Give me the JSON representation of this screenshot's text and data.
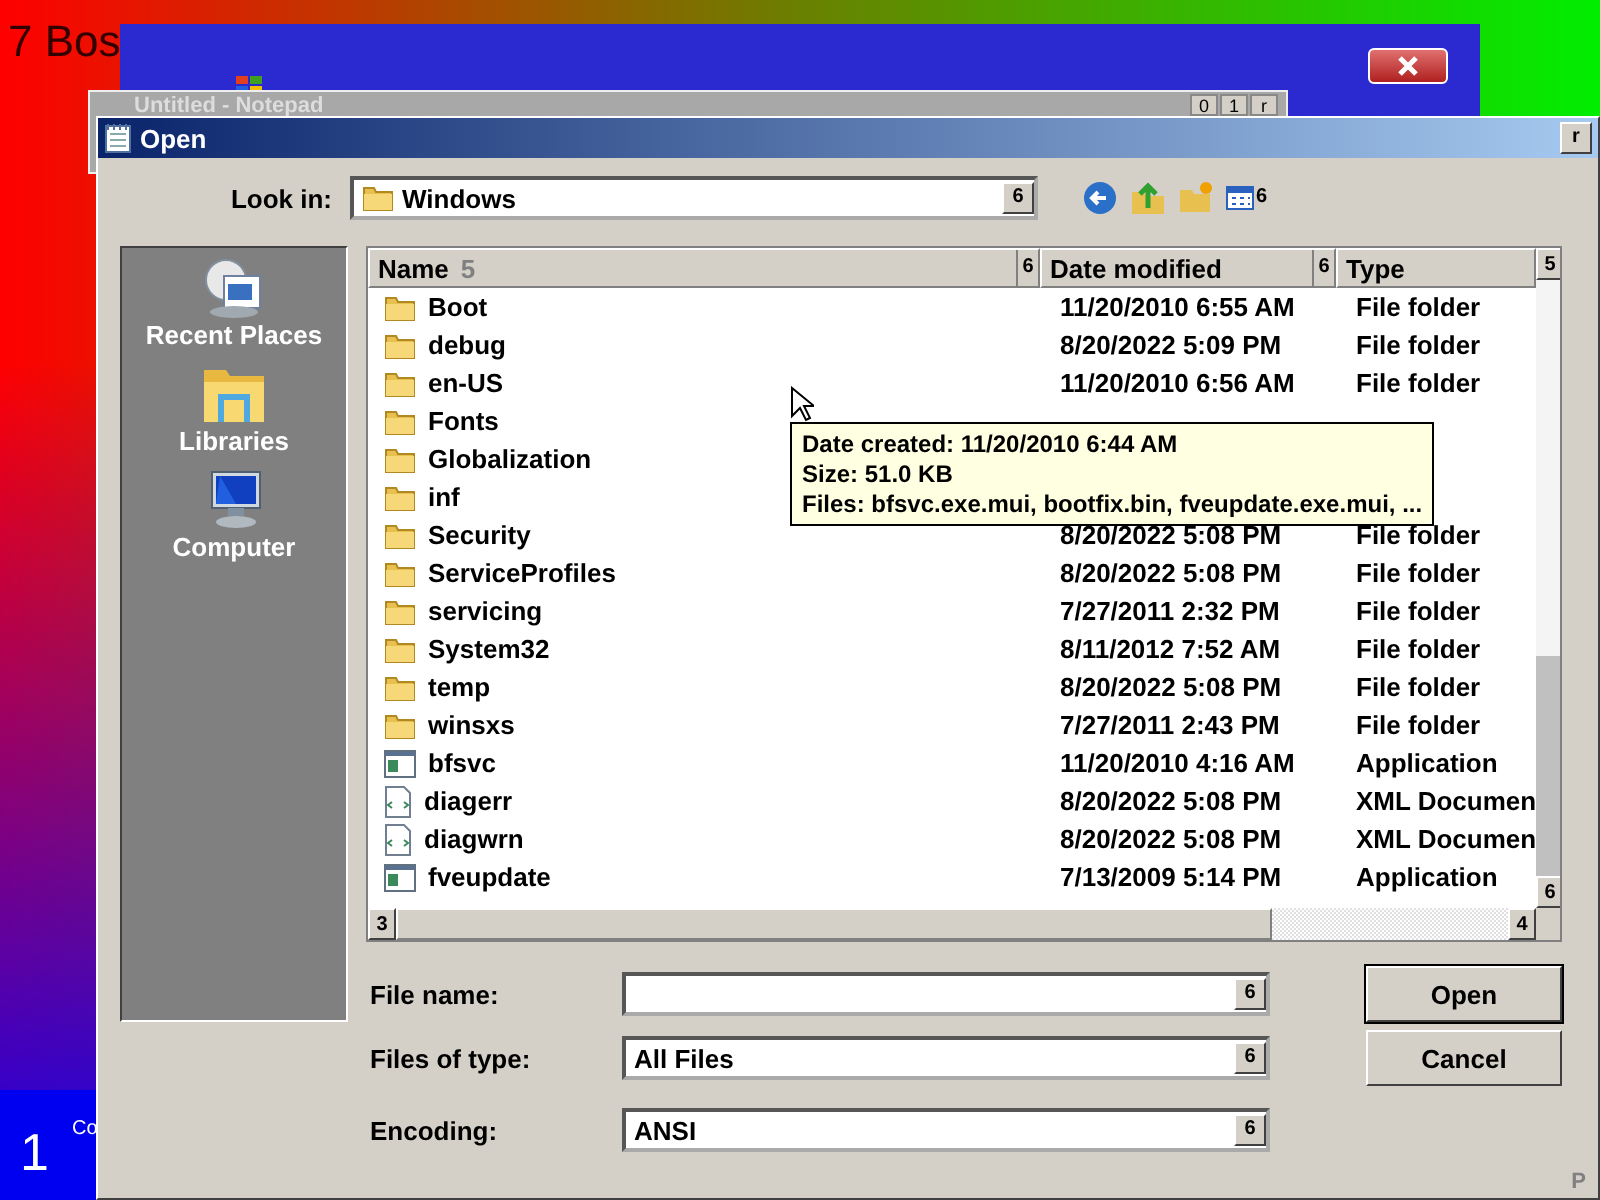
{
  "desktop": {
    "corner_text": "7 Bos",
    "taskbar_number": "1",
    "taskbar_label": "Co"
  },
  "notepad_window": {
    "title": "Untitled - Notepad",
    "buttons": [
      "0",
      "1",
      "r"
    ]
  },
  "dialog": {
    "title": "Open",
    "close_glyph": "r",
    "look_in": {
      "label": "Look in:",
      "value": "Windows",
      "dropdown_glyph": "6"
    },
    "view_menu_glyph": "6",
    "places": [
      {
        "label": "Recent Places",
        "kind": "recent"
      },
      {
        "label": "Libraries",
        "kind": "libraries"
      },
      {
        "label": "Computer",
        "kind": "computer"
      }
    ],
    "file_list": {
      "columns": [
        {
          "label": "Name",
          "sort_glyph": "5",
          "menu_glyph": "6"
        },
        {
          "label": "Date modified",
          "menu_glyph": "6"
        },
        {
          "label": "Type"
        }
      ],
      "scroll_up_glyph": "5",
      "scroll_down_glyph": "6",
      "scroll_left_glyph": "3",
      "scroll_right_glyph": "4",
      "rows": [
        {
          "name": "Boot",
          "date": "11/20/2010 6:55 AM",
          "type": "File folder",
          "kind": "folder"
        },
        {
          "name": "debug",
          "date": "8/20/2022 5:09 PM",
          "type": "File folder",
          "kind": "folder"
        },
        {
          "name": "en-US",
          "date": "11/20/2010 6:56 AM",
          "type": "File folder",
          "kind": "folder"
        },
        {
          "name": "Fonts",
          "kind": "folder"
        },
        {
          "name": "Globalization",
          "kind": "folder"
        },
        {
          "name": "inf",
          "kind": "folder"
        },
        {
          "name": "Security",
          "date": "8/20/2022 5:08 PM",
          "type": "File folder",
          "kind": "folder"
        },
        {
          "name": "ServiceProfiles",
          "date": "8/20/2022 5:08 PM",
          "type": "File folder",
          "kind": "folder"
        },
        {
          "name": "servicing",
          "date": "7/27/2011 2:32 PM",
          "type": "File folder",
          "kind": "folder"
        },
        {
          "name": "System32",
          "date": "8/11/2012 7:52 AM",
          "type": "File folder",
          "kind": "folder"
        },
        {
          "name": "temp",
          "date": "8/20/2022 5:08 PM",
          "type": "File folder",
          "kind": "folder"
        },
        {
          "name": "winsxs",
          "date": "7/27/2011 2:43 PM",
          "type": "File folder",
          "kind": "folder"
        },
        {
          "name": "bfsvc",
          "date": "11/20/2010 4:16 AM",
          "type": "Application",
          "kind": "application"
        },
        {
          "name": "diagerr",
          "date": "8/20/2022 5:08 PM",
          "type": "XML Documen",
          "kind": "xml"
        },
        {
          "name": "diagwrn",
          "date": "8/20/2022 5:08 PM",
          "type": "XML Documen",
          "kind": "xml"
        },
        {
          "name": "fveupdate",
          "date": "7/13/2009 5:14 PM",
          "type": "Application",
          "kind": "application"
        }
      ]
    },
    "tooltip": {
      "lines": [
        "Date created: 11/20/2010 6:44 AM",
        "Size: 51.0 KB",
        "Files: bfsvc.exe.mui, bootfix.bin, fveupdate.exe.mui, ..."
      ]
    },
    "fields": [
      {
        "label": "File name:",
        "dropdown_glyph": "6"
      },
      {
        "label": "Files of type:",
        "value": "All Files",
        "dropdown_glyph": "6"
      },
      {
        "label": "Encoding:",
        "value": "ANSI",
        "dropdown_glyph": "6"
      }
    ],
    "buttons": [
      {
        "label": "Open",
        "default": true
      },
      {
        "label": "Cancel",
        "default": false
      }
    ],
    "grip_glyph": "P"
  }
}
